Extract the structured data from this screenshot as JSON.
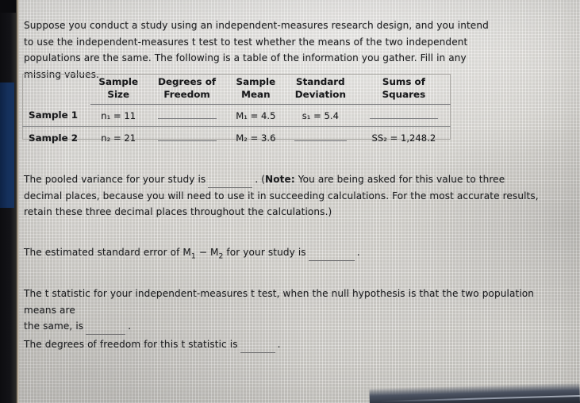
{
  "document": {
    "intro": "Suppose you conduct a study using an independent-measures research design, and you intend to use the independent-measures t test to test whether the means of the two independent populations are the same. The following is a table of the information you gather. Fill in any missing values.",
    "pooled_variance_prefix": "The pooled variance for your study is",
    "pooled_variance_note_lead": ". (",
    "pooled_variance_note_label": "Note:",
    "pooled_variance_note_body": " You are being asked for this value to three decimal places, because you will need to use it in succeeding calculations. For the most accurate results, retain these three decimal places throughout the calculations.)",
    "standard_error_prefix": "The estimated standard error of M",
    "standard_error_sub1": "1",
    "standard_error_mid": " − M",
    "standard_error_sub2": "2",
    "standard_error_suffix": " for your study is",
    "standard_error_end": ".",
    "tstat_line1": "The t statistic for your independent-measures t test, when the null hypothesis is that the two population means are",
    "tstat_line2_prefix": "the same, is",
    "tstat_line2_end": ".",
    "df_prefix": "The degrees of freedom for this t statistic is",
    "df_end": "."
  },
  "table": {
    "headers": [
      {
        "line1": "",
        "line2": ""
      },
      {
        "line1": "Sample",
        "line2": "Size"
      },
      {
        "line1": "Degrees of",
        "line2": "Freedom"
      },
      {
        "line1": "Sample",
        "line2": "Mean"
      },
      {
        "line1": "Standard",
        "line2": "Deviation"
      },
      {
        "line1": "Sums of",
        "line2": "Squares"
      }
    ],
    "rows": [
      {
        "label": "Sample 1",
        "sample_size": "n₁ = 11",
        "degrees_of_freedom": "",
        "sample_mean": "M₁ = 4.5",
        "standard_deviation": "s₁ = 5.4",
        "sums_of_squares": ""
      },
      {
        "label": "Sample 2",
        "sample_size": "n₂ = 21",
        "degrees_of_freedom": "",
        "sample_mean": "M₂ = 3.6",
        "standard_deviation": "",
        "sums_of_squares": "SS₂ = 1,248.2"
      }
    ]
  },
  "colors": {
    "paper": "#d9d7d2",
    "ink": "#1d1e20",
    "bezel_dark": "#121216",
    "bezel_blue": "#15305c",
    "rule": "#8d8e90"
  }
}
